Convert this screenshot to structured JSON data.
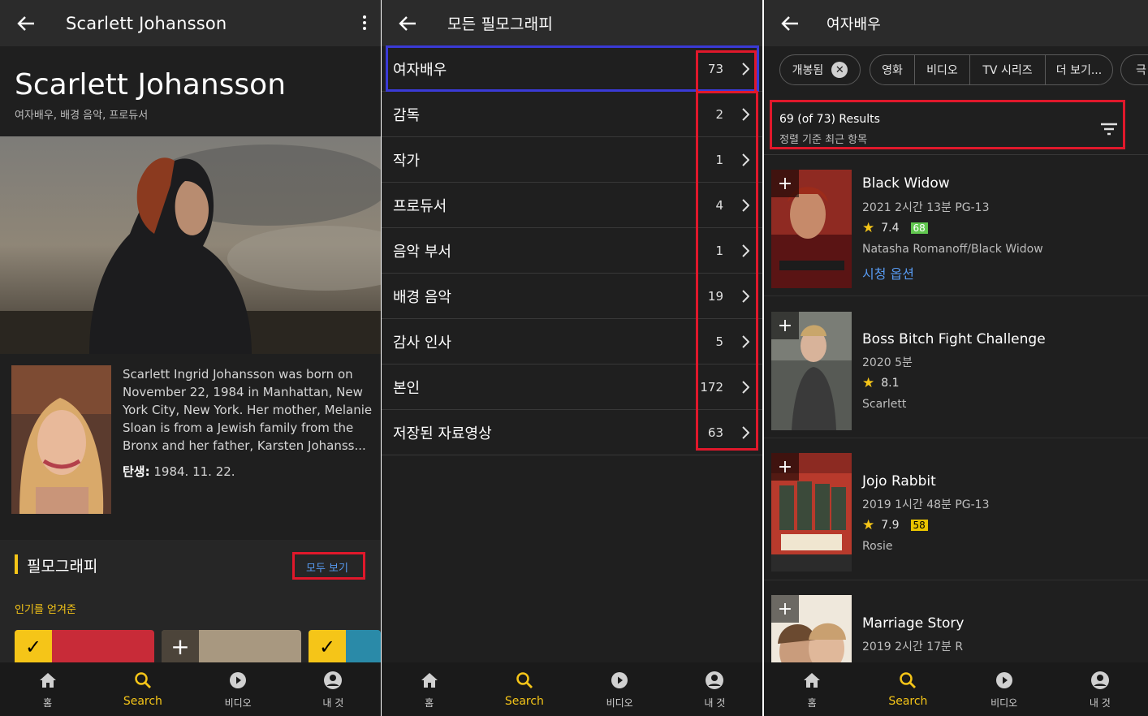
{
  "colors": {
    "accent": "#f5c518",
    "link": "#5799ef",
    "highlight_red": "#e0182b",
    "highlight_blue": "#3a3ad6",
    "meta_green": "#61c74f",
    "meta_yellow": "#e8c300"
  },
  "screen1": {
    "appbar_title": "Scarlett Johansson",
    "name": "Scarlett Johansson",
    "roles": "여자배우, 배경 음악, 프로듀서",
    "bio": "Scarlett Ingrid Johansson was born on November 22, 1984 in Manhattan, New York City, New York. Her mother, Melanie Sloan is from a Jewish family from the Bronx and her father, Karsten Johanss...",
    "birth_label": "탄생:",
    "birth_value": " 1984. 11. 22.",
    "filmography_title": "필모그래피",
    "see_all": "모두 보기",
    "popular_label": "인기를 얻겨준"
  },
  "screen2": {
    "appbar_title": "모든 필모그래피",
    "categories": [
      {
        "label": "여자배우",
        "count": "73"
      },
      {
        "label": "감독",
        "count": "2"
      },
      {
        "label": "작가",
        "count": "1"
      },
      {
        "label": "프로듀서",
        "count": "4"
      },
      {
        "label": "음악 부서",
        "count": "1"
      },
      {
        "label": "배경 음악",
        "count": "19"
      },
      {
        "label": "감사 인사",
        "count": "5"
      },
      {
        "label": "본인",
        "count": "172"
      },
      {
        "label": "저장된 자료영상",
        "count": "63"
      }
    ]
  },
  "screen3": {
    "appbar_title": "여자배우",
    "chips": [
      "개봉됨",
      "영화",
      "비디오",
      "TV 시리즈",
      "더 보기...",
      "극"
    ],
    "results_count": "69 (of 73) Results",
    "results_sort": "정렬 기준 최근 항목",
    "movies": [
      {
        "title": "Black Widow",
        "meta": "2021  2시간 13분  PG-13",
        "rating": "7.4",
        "metascore": "68",
        "role": "Natasha Romanoff/Black Widow",
        "watch": "시청 옵션"
      },
      {
        "title": "Boss Bitch Fight Challenge",
        "meta": "2020  5분",
        "rating": "8.1",
        "metascore": "",
        "role": "Scarlett",
        "watch": ""
      },
      {
        "title": "Jojo Rabbit",
        "meta": "2019  1시간 48분  PG-13",
        "rating": "7.9",
        "metascore": "58",
        "role": "Rosie",
        "watch": ""
      },
      {
        "title": "Marriage Story",
        "meta": "2019  2시간 17분  R",
        "rating": "",
        "metascore": "",
        "role": "",
        "watch": ""
      }
    ]
  },
  "bottomnav": {
    "home": "홈",
    "search": "Search",
    "video": "비디오",
    "you": "내 것"
  }
}
